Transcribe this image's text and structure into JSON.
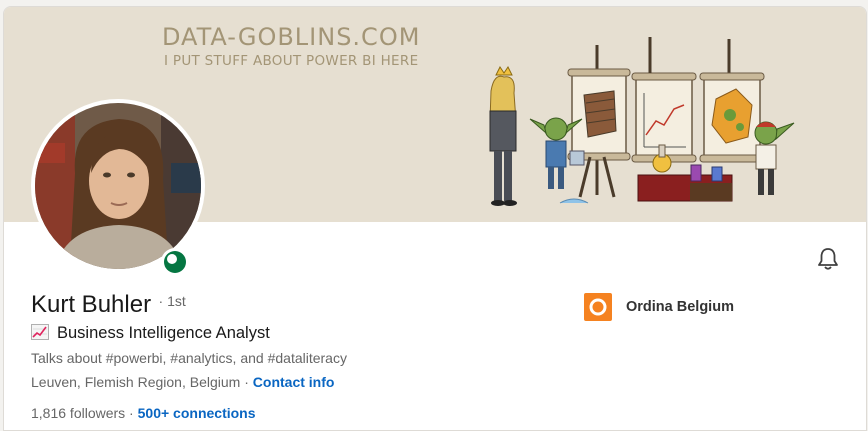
{
  "banner": {
    "title": "DATA-GOBLINS.COM",
    "subtitle": "I PUT STUFF ABOUT POWER BI HERE"
  },
  "profile": {
    "name": "Kurt Buhler",
    "degree": "· 1st",
    "headline": "Business Intelligence Analyst",
    "headline_icon": "chart-increasing-emoji",
    "talks_about": "Talks about #powerbi, #analytics, and #dataliteracy",
    "location": "Leuven, Flemish Region, Belgium",
    "location_separator": " · ",
    "contact_info": "Contact info",
    "followers": "1,816 followers",
    "followers_separator": " · ",
    "connections": "500+ connections",
    "status": "online"
  },
  "company": {
    "name": "Ordina Belgium",
    "logo_color": "#f58220"
  },
  "colors": {
    "banner_bg": "#e6dfd1",
    "banner_text": "#a39576",
    "link": "#0a66c2",
    "online": "#057642"
  },
  "icons": {
    "notify": "bell-icon"
  }
}
